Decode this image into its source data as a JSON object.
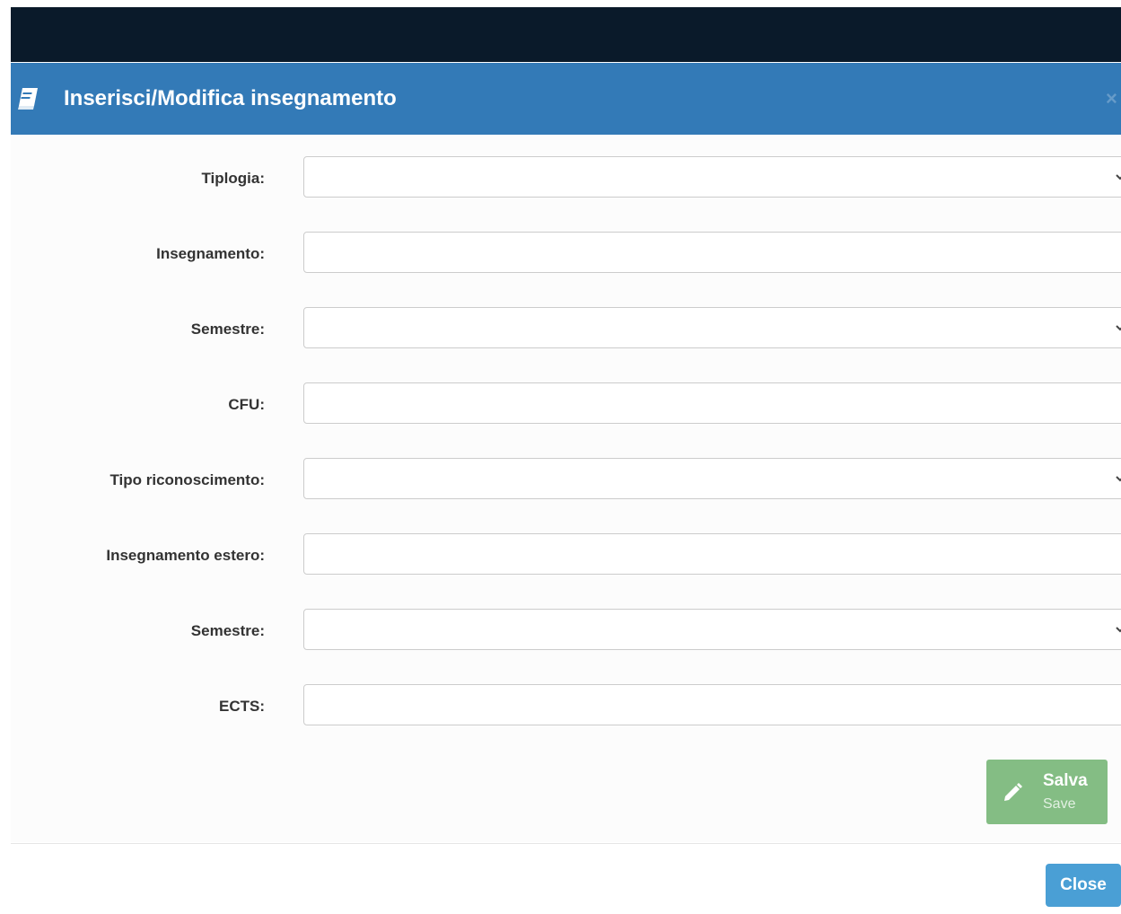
{
  "modal": {
    "title": "Inserisci/Modifica insegnamento",
    "header_icon": "book-icon",
    "close_glyph": "×"
  },
  "form": {
    "fields": [
      {
        "label": "Tiplogia:",
        "type": "select",
        "value": ""
      },
      {
        "label": "Insegnamento:",
        "type": "text",
        "value": ""
      },
      {
        "label": "Semestre:",
        "type": "select",
        "value": ""
      },
      {
        "label": "CFU:",
        "type": "text",
        "value": ""
      },
      {
        "label": "Tipo riconoscimento:",
        "type": "select",
        "value": ""
      },
      {
        "label": "Insegnamento estero:",
        "type": "text",
        "value": ""
      },
      {
        "label": "Semestre:",
        "type": "select",
        "value": ""
      },
      {
        "label": "ECTS:",
        "type": "text",
        "value": ""
      }
    ]
  },
  "buttons": {
    "save_label": "Salva",
    "save_sublabel": "Save",
    "save_icon": "pencil-icon",
    "close_label": "Close"
  },
  "colors": {
    "header_bg": "#337ab7",
    "topbar_bg": "#0a1a2a",
    "save_bg": "#84bd84",
    "close_bg": "#4a9fd5"
  }
}
